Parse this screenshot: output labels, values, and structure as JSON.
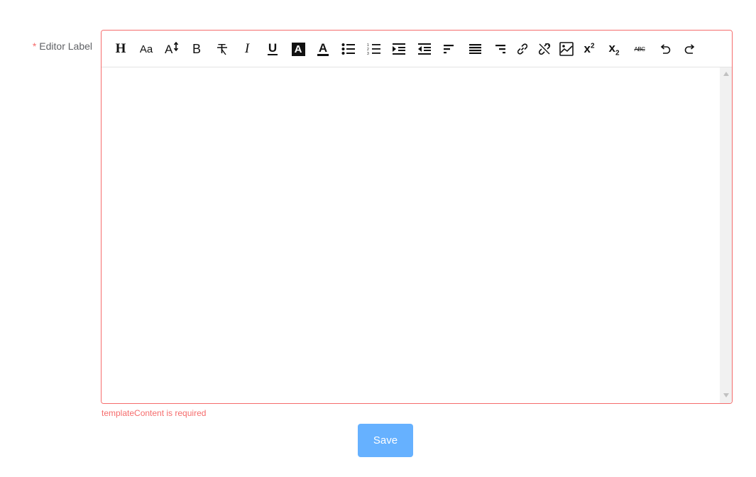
{
  "form": {
    "required_mark": "*",
    "label": "Editor Label",
    "error": "templateContent is required",
    "save_label": "Save"
  },
  "toolbar": {
    "items": [
      {
        "icon": "heading-icon",
        "text": "H"
      },
      {
        "icon": "font-size-icon",
        "text": "Aa"
      },
      {
        "icon": "line-height-icon",
        "text": "A"
      },
      {
        "icon": "bold-icon",
        "text": "B"
      },
      {
        "icon": "clear-format-icon",
        "text": "T"
      },
      {
        "icon": "italic-icon",
        "text": "I"
      },
      {
        "icon": "underline-icon",
        "text": "U"
      },
      {
        "icon": "background-color-icon",
        "text": "A"
      },
      {
        "icon": "font-color-icon",
        "text": "A"
      },
      {
        "icon": "bullet-list-icon"
      },
      {
        "icon": "numbered-list-icon"
      },
      {
        "icon": "indent-icon"
      },
      {
        "icon": "outdent-icon"
      },
      {
        "icon": "align-left-icon"
      },
      {
        "icon": "align-justify-icon"
      },
      {
        "icon": "align-right-icon"
      },
      {
        "icon": "link-icon"
      },
      {
        "icon": "unlink-icon"
      },
      {
        "icon": "image-icon"
      },
      {
        "icon": "superscript-icon",
        "text": "x",
        "sup": "2"
      },
      {
        "icon": "subscript-icon",
        "text": "x",
        "sub": "2"
      },
      {
        "icon": "strikethrough-icon",
        "text": "ABC"
      },
      {
        "icon": "undo-icon"
      },
      {
        "icon": "redo-icon"
      }
    ]
  },
  "colors": {
    "error": "#f56c6c",
    "button": "#66b1ff",
    "label": "#606266"
  }
}
